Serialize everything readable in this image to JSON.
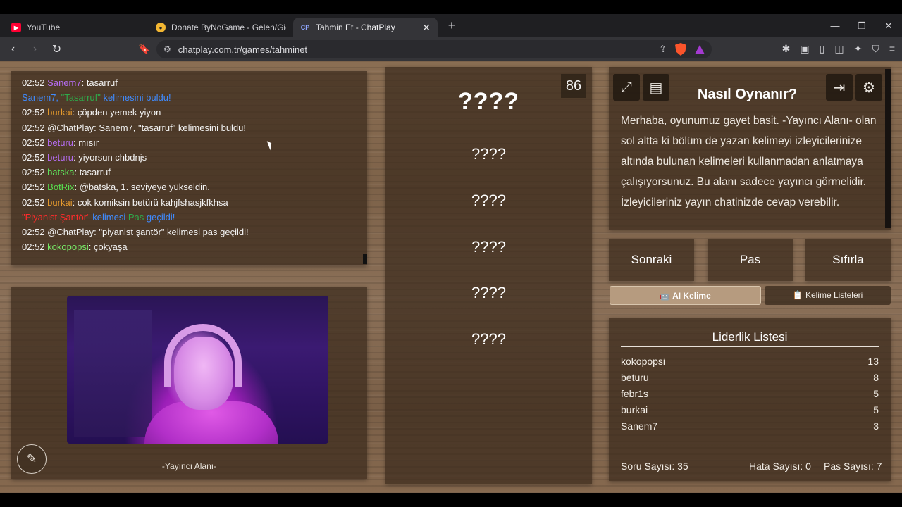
{
  "browser": {
    "tabs": [
      {
        "title": "YouTube",
        "favicon": "youtube-icon"
      },
      {
        "title": "Donate ByNoGame - Gelen/Giden Ba",
        "favicon": "bynogame-icon"
      },
      {
        "title": "Tahmin Et - ChatPlay",
        "favicon": "chatplay-icon",
        "active": true
      }
    ],
    "url": "chatplay.com.tr/games/tahminet"
  },
  "chat": {
    "lines": [
      {
        "time": "02:52",
        "user": "Sanem7",
        "msg": ": tasarruf"
      },
      {
        "sys1": "Sanem7,",
        "sys2": "\"Tasarruf\"",
        "sys3": "kelimesini buldu!"
      },
      {
        "time": "02:52",
        "user": "burkai",
        "msg": ": çöpden yemek yiyon"
      },
      {
        "time": "02:52",
        "user": "@ChatPlay",
        "msg": ": Sanem7, \"tasarruf\" kelimesini buldu!"
      },
      {
        "time": "02:52",
        "user": "beturu",
        "msg": ": mısır"
      },
      {
        "time": "02:52",
        "user": "beturu",
        "msg": ": yiyorsun chbdnjs"
      },
      {
        "time": "02:52",
        "user": "batska",
        "msg": ": tasarruf"
      },
      {
        "time": "02:52",
        "user": "BotRix",
        "msg": ": @batska, 1. seviyeye yükseldin."
      },
      {
        "time": "02:52",
        "user": "burkai",
        "msg": ": cok komiksin betürü kahjfshasjkfkhsa"
      },
      {
        "pas1": "\"Piyanist Şantör\"",
        "pas2": "kelimesi",
        "pas3": "Pas",
        "pas4": "geçildi!"
      },
      {
        "time": "02:52",
        "user": "@ChatPlay",
        "msg": ": \"piyanist şantör\" kelimesi pas geçildi!"
      },
      {
        "time": "02:52",
        "user": "kokopopsi",
        "msg": ": çokyaşa"
      }
    ]
  },
  "streamer": {
    "label": "-Yayıncı Alanı-"
  },
  "words": {
    "main": "????",
    "others": [
      "????",
      "????",
      "????",
      "????",
      "????"
    ],
    "timer": "86"
  },
  "howto": {
    "title": "Nasıl Oynanır?",
    "text": "Merhaba, oyunumuz gayet basit. -Yayıncı Alanı- olan sol altta ki bölüm de yazan kelimeyi izleyicilerinize altında bulunan kelimeleri kullanmadan anlatmaya çalışıyorsunuz. Bu alanı sadece yayıncı görmelidir. İzleyicileriniz yayın chatinizde cevap verebilir."
  },
  "actions": {
    "next": "Sonraki",
    "pass": "Pas",
    "reset": "Sıfırla"
  },
  "tabs": {
    "ai": "🤖 AI Kelime",
    "lists": "📋 Kelime Listeleri"
  },
  "leaderboard": {
    "title": "Liderlik Listesi",
    "rows": [
      {
        "name": "kokopopsi",
        "score": "13"
      },
      {
        "name": "beturu",
        "score": "8"
      },
      {
        "name": "febr1s",
        "score": "5"
      },
      {
        "name": "burkai",
        "score": "5"
      },
      {
        "name": "Sanem7",
        "score": "3"
      }
    ],
    "question_count": "Soru Sayısı: 35",
    "error_count": "Hata Sayısı: 0",
    "pass_count": "Pas Sayısı: 7"
  }
}
